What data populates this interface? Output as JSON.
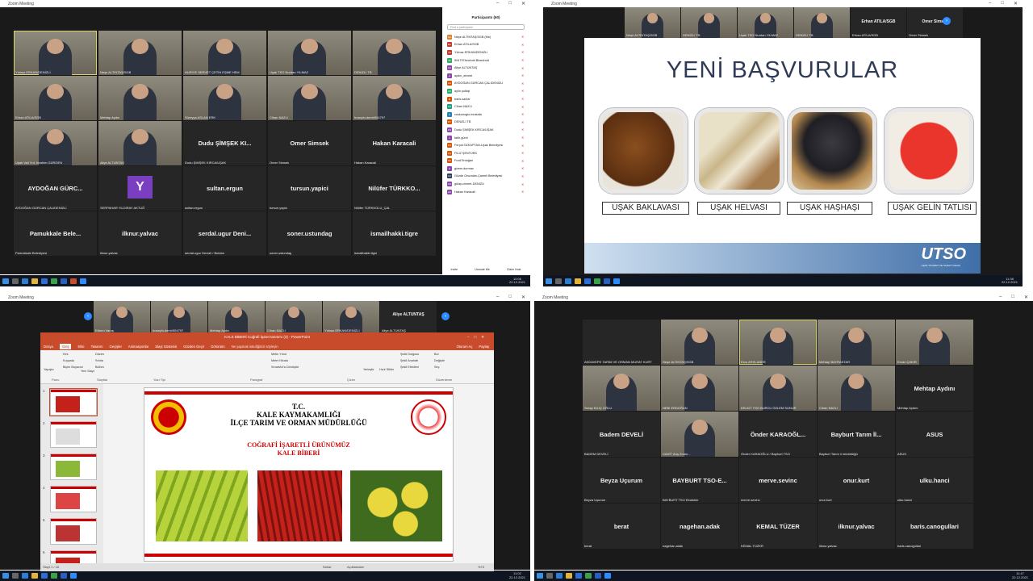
{
  "window_title": "Zoom Meeting",
  "q1": {
    "tiles": [
      {
        "name": "Yılmaz ERKAN/DENİZLİ",
        "video": true,
        "active": true
      },
      {
        "name": "Neşe ALTINTAŞ/SGB",
        "video": true
      },
      {
        "name": "HURİYE SERVET ÇETİN EŞME HEM",
        "video": true
      },
      {
        "name": "Uşak TSO Nurdan YILMAZ",
        "video": true
      },
      {
        "name": "DENİZLİ TB",
        "video": true
      },
      {
        "name": "Erhan ATİLA/SGB",
        "video": true
      },
      {
        "name": "Mehtap Aydın",
        "video": true
      },
      {
        "name": "Süreyya ASLAN ERK",
        "video": true
      },
      {
        "name": "Cihan NAZLI",
        "video": true
      },
      {
        "name": "huseyin.demir504797",
        "video": true
      },
      {
        "name": "Uşak Vali Yrd. İbrahim GÜRGEN",
        "video": true
      },
      {
        "name": "Aliye ALTUNTAŞ",
        "video": true
      },
      {
        "name": "Dudu ŞİMŞEK KIRCA/UŞAK",
        "label": "Dudu ŞİMŞEK KI..."
      },
      {
        "name": "Omer Simsek",
        "label": "Omer Simsek"
      },
      {
        "name": "Hakan Karacali",
        "label": "Hakan Karacali"
      },
      {
        "name": "AYDOĞAN GÜRCAN ÇALIDENİZLİ",
        "label": "AYDOĞAN GÜRC..."
      },
      {
        "name": "SERPAHAR YILDIRAY AKTUĞ",
        "label": "Y",
        "avatar": true
      },
      {
        "name": "sultan.ergun",
        "label": "sultan.ergun"
      },
      {
        "name": "tursun.yapici",
        "label": "tursun.yapici"
      },
      {
        "name": "Nilüfer TÜRKKOLU_ÇAL",
        "label": "Nilüfer TÜRKKO..."
      },
      {
        "name": "Pamukkale Belediyesi",
        "label": "Pamukkale Bele..."
      },
      {
        "name": "ilknur.yalvac",
        "label": "ilknur.yalvac"
      },
      {
        "name": "serdal.ugur Denizli / Buldan",
        "label": "serdal.ugur Deni..."
      },
      {
        "name": "soner.ustundag",
        "label": "soner.ustundag"
      },
      {
        "name": "ismailhakki.tigre",
        "label": "ismailhakki.tigre"
      }
    ],
    "participants_title": "Participants (60)",
    "search_placeholder": "Find a participant",
    "participants": [
      {
        "i": "NA",
        "n": "Neşe ALTINTAŞ/SGB (Me)",
        "c": "#d9822b"
      },
      {
        "i": "EA",
        "n": "Erhan ATİLA/SGB",
        "c": "#c0392b"
      },
      {
        "i": "YE",
        "n": "Yılmaz ERKAN/DENİZLİ",
        "c": "#c0392b"
      },
      {
        "i": "50",
        "n": "504797Android Bluedroid",
        "c": "#27ae60"
      },
      {
        "i": "AA",
        "n": "Aliye ALTUNTAŞ",
        "c": "#8e44ad"
      },
      {
        "i": "A",
        "n": "aydın_ahmet",
        "c": "#8e44ad"
      },
      {
        "i": "AG",
        "n": "AYDOĞAN GÜRCAN ÇALIDENİZLİ",
        "c": "#d35400"
      },
      {
        "i": "AS",
        "n": "aylin şolkişi",
        "c": "#27ae60"
      },
      {
        "i": "B",
        "n": "baris.sanlar",
        "c": "#d35400"
      },
      {
        "i": "CN",
        "n": "Cihan NAZLI",
        "c": "#16a085"
      },
      {
        "i": "C",
        "n": "coskunoglu.mustafa",
        "c": "#2980b9"
      },
      {
        "i": "DT",
        "n": "DENİZLİ TB",
        "c": "#d35400"
      },
      {
        "i": "DŞ",
        "n": "Dudu ŞİMŞEK KIRCA/UŞAK",
        "c": "#8e44ad"
      },
      {
        "i": "F",
        "n": "fatih.gürel",
        "c": "#8e44ad"
      },
      {
        "i": "FÖ",
        "n": "Ferçal ÖZKAPTAN-Uşak Belediyesi",
        "c": "#d35400"
      },
      {
        "i": "FŞ",
        "n": "FİLİZ ŞENTÜRK",
        "c": "#d35400"
      },
      {
        "i": "FE",
        "n": "Fırat Erdoğan",
        "c": "#d35400"
      },
      {
        "i": "G",
        "n": "gizem.durmaz",
        "c": "#8e44ad"
      },
      {
        "i": "GÇ",
        "n": "Gözde Onuralan-Çameli Belediyesi",
        "c": "#2c3e50"
      },
      {
        "i": "GD",
        "n": "gülay.cömert-DENİZLİ",
        "c": "#8e44ad"
      },
      {
        "i": "HK",
        "n": "Hakan Karacali",
        "c": "#8e44ad"
      }
    ],
    "footer": [
      "Invite",
      "Unmute Me",
      "Claim Host"
    ],
    "clock": "10:06",
    "date": "22.12.2021"
  },
  "q2": {
    "strip": [
      {
        "name": "Neşe ALTINTAŞ/SGB"
      },
      {
        "name": "DENİZLİ TB"
      },
      {
        "name": "Uşak TSO Nurdan YILMAZ"
      },
      {
        "name": "DENİZLİ TB"
      },
      {
        "name": "Erhan ATİLA/SGB",
        "label": "Erhan ATİLA/SGB"
      },
      {
        "name": "Omer Simsek",
        "label": "Omer Simsek"
      }
    ],
    "slide_title": "YENİ BAŞVURULAR",
    "items": [
      "UŞAK BAKLAVASI",
      "UŞAK HELVASI",
      "UŞAK HAŞHAŞI",
      "UŞAK GELİN TATLISI"
    ],
    "logo": "UTSO",
    "logo_sub": "UŞAK TİCARET VE SANAYİ ODASI",
    "clock": "11:38",
    "date": "22.12.2021"
  },
  "q3": {
    "strip": [
      {
        "name": "Ethem Varuş"
      },
      {
        "name": "huseyin.demir504797"
      },
      {
        "name": "Mehtap Aydın"
      },
      {
        "name": "Cihan NAZLI"
      },
      {
        "name": "Yılmaz ERKAN/DENİZLİ"
      },
      {
        "name": "Aliye ALTUNTAŞ",
        "label": "Aliye ALTUNTAŞ"
      }
    ],
    "ppt_title": "KALE BİBERİ Coğrafi İşaret tanıtımı (3) - PowerPoint",
    "ppt_user": "Oturum Aç",
    "share": "Paylaş",
    "tabs": [
      "Dosya",
      "Giriş",
      "Ekle",
      "Tasarım",
      "Geçişler",
      "Animasyonlar",
      "Slayt Gösterisi",
      "Gözden Geçir",
      "Görünüm"
    ],
    "tell_me": "Ne yapmak istediğinizi söyleyin",
    "groups": [
      "Pano",
      "Slaytlar",
      "Yazı Tipi",
      "Paragraf",
      "Çizim",
      "Düzenleme"
    ],
    "ribbon_items": [
      "Kes",
      "Kopyala",
      "Biçim Boyacısı",
      "Yapıştır",
      "Yeni Slayt",
      "Düzen",
      "Sıfırla",
      "Bölüm",
      "Metin Yönü",
      "Metni Hizala",
      "SmartArt'a Dönüştür",
      "Yerleştir",
      "Hızlı Stiller",
      "Şekil Dolgusu",
      "Şekil Anahatı",
      "Şekil Efektleri",
      "Bul",
      "Değiştir",
      "Seç"
    ],
    "slide_header": "T.C.",
    "slide_l1": "KALE KAYMAKAMLIĞI",
    "slide_l2": "İLÇE TARIM VE ORMAN MÜDÜRLÜĞÜ",
    "slide_red1": "COĞRAFİ İŞARETLİ ÜRÜNÜMÜZ",
    "slide_red2": "KALE BİBERİ",
    "status": "Slayt 1 / 18",
    "notes": "Notlar",
    "comments": "Açıklamalar",
    "zoom": "%73",
    "thumb_nums": [
      "1",
      "2",
      "3",
      "4",
      "5",
      "6"
    ],
    "clock": "11:02",
    "date": "22.12.2021"
  },
  "q4": {
    "tiles": [
      {
        "name": "AKDAVEPE TARIM VE ORMAN MURAT KURT",
        "video": false
      },
      {
        "name": "Neşe ALTINTAŞ/SGB",
        "video": true
      },
      {
        "name": "Esra ARSLANER",
        "video": true,
        "active": true
      },
      {
        "name": "Mehtap BAYRAKTAR",
        "video": true
      },
      {
        "name": "Ercan ÇAKIR",
        "video": true
      },
      {
        "name": "Serap KILIÇ OĞLU",
        "video": true
      },
      {
        "name": "NEBİ ERDOĞAN",
        "video": true
      },
      {
        "name": "KELKİT TSO BURCU ÖZLEM SUNUR",
        "video": true
      },
      {
        "name": "Cihan NAZLI",
        "video": true
      },
      {
        "name": "Mehtap Aydını",
        "label": "Mehtap Aydını"
      },
      {
        "name": "BADEM DEVELİ",
        "label": "Badem DEVELİ"
      },
      {
        "name": "CAHİT Arış Zomo...",
        "video": true
      },
      {
        "name": "Önder KARAOĞLU / Bayburt TSO",
        "label": "Önder KARAOĞL..."
      },
      {
        "name": "Bayburt Tarım il müdürlüğü",
        "label": "Bayburt Tarım İl..."
      },
      {
        "name": "ASUS",
        "label": "ASUS"
      },
      {
        "name": "Beyza Uçurum",
        "label": "Beyza Uçurum"
      },
      {
        "name": "BAYBURT TSO Ebubekir",
        "label": "BAYBURT TSO-E..."
      },
      {
        "name": "merve.sevinc",
        "label": "merve.sevinc"
      },
      {
        "name": "onur.kurt",
        "label": "onur.kurt"
      },
      {
        "name": "ulku.hanci",
        "label": "ulku.hanci"
      },
      {
        "name": "berat",
        "label": "berat"
      },
      {
        "name": "nagehan.adak",
        "label": "nagehan.adak"
      },
      {
        "name": "KEMAL TÜZER",
        "label": "KEMAL TÜZER"
      },
      {
        "name": "ilknur.yalvac",
        "label": "ilknur.yalvac"
      },
      {
        "name": "baris.canogullari",
        "label": "baris.canogullari"
      }
    ],
    "clock": "11:47",
    "date": "22.12.2021"
  },
  "colors": {
    "zoom_bg": "#1a1a1a",
    "ppt_accent": "#c84b2b",
    "active": "#d9d36b",
    "taskbar": "#101522"
  }
}
